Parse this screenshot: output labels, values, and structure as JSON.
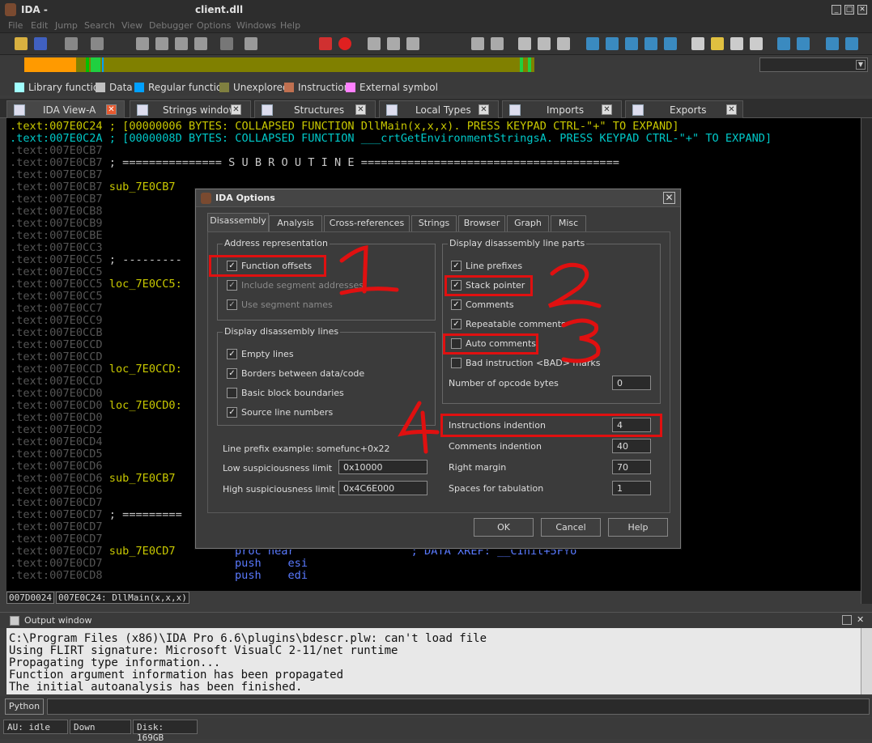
{
  "window": {
    "app": "IDA -",
    "file": "client.dll"
  },
  "menu": [
    "File",
    "Edit",
    "Jump",
    "Search",
    "View",
    "Debugger",
    "Options",
    "Windows",
    "Help"
  ],
  "legend": [
    {
      "label": "Library function",
      "color": "#a0ffff"
    },
    {
      "label": "Data",
      "color": "#c0c0c0"
    },
    {
      "label": "Regular function",
      "color": "#00a0ff"
    },
    {
      "label": "Unexplored",
      "color": "#808040"
    },
    {
      "label": "Instruction",
      "color": "#c07050"
    },
    {
      "label": "External symbol",
      "color": "#ff80ff"
    }
  ],
  "tabs": [
    {
      "label": "IDA View-A",
      "active": true
    },
    {
      "label": "Strings window"
    },
    {
      "label": "Structures"
    },
    {
      "label": "Local Types"
    },
    {
      "label": "Imports"
    },
    {
      "label": "Exports"
    }
  ],
  "disasm": {
    "lines": [
      {
        "addr": ".text:007E0C24",
        "text": " ; [00000006 BYTES: COLLAPSED FUNCTION DllMain(x,x,x). PRESS KEYPAD CTRL-\"+\" TO EXPAND]",
        "style": "y"
      },
      {
        "addr": ".text:007E0C2A",
        "text": " ; [0000008D BYTES: COLLAPSED FUNCTION ___crtGetEnvironmentStringsA. PRESS KEYPAD CTRL-\"+\" TO EXPAND]",
        "style": "c"
      },
      {
        "addr": ".text:007E0CB7",
        "text": "",
        "style": "g"
      },
      {
        "addr": ".text:007E0CB7",
        "text": " ; =============== S U B R O U T I N E =======================================",
        "style": "g"
      },
      {
        "addr": ".text:007E0CB7",
        "text": "",
        "style": "g"
      },
      {
        "addr": ".text:007E0CB7",
        "text": " sub_7E0CB7",
        "style": "g"
      },
      {
        "addr": ".text:007E0CB7",
        "text": "",
        "style": "g"
      },
      {
        "addr": ".text:007E0CB8",
        "text": "",
        "style": "g"
      },
      {
        "addr": ".text:007E0CB9",
        "text": "",
        "style": "g"
      },
      {
        "addr": ".text:007E0CBE",
        "text": "",
        "style": "g"
      },
      {
        "addr": ".text:007E0CC3",
        "text": "",
        "style": "g"
      },
      {
        "addr": ".text:007E0CC5",
        "text": " ; ---------",
        "style": "g"
      },
      {
        "addr": ".text:007E0CC5",
        "text": "",
        "style": "g"
      },
      {
        "addr": ".text:007E0CC5",
        "text": " loc_7E0CC5:",
        "style": "g"
      },
      {
        "addr": ".text:007E0CC5",
        "text": "",
        "style": "g"
      },
      {
        "addr": ".text:007E0CC7",
        "text": "",
        "style": "g"
      },
      {
        "addr": ".text:007E0CC9",
        "text": "",
        "style": "g"
      },
      {
        "addr": ".text:007E0CCB",
        "text": "",
        "style": "g"
      },
      {
        "addr": ".text:007E0CCD",
        "text": "",
        "style": "g"
      },
      {
        "addr": ".text:007E0CCD",
        "text": "",
        "style": "g"
      },
      {
        "addr": ".text:007E0CCD",
        "text": " loc_7E0CCD:",
        "style": "g"
      },
      {
        "addr": ".text:007E0CCD",
        "text": "",
        "style": "g"
      },
      {
        "addr": ".text:007E0CD0",
        "text": "",
        "style": "g"
      },
      {
        "addr": ".text:007E0CD0",
        "text": " loc_7E0CD0:",
        "style": "g"
      },
      {
        "addr": ".text:007E0CD0",
        "text": "",
        "style": "g"
      },
      {
        "addr": ".text:007E0CD2",
        "text": "",
        "style": "g"
      },
      {
        "addr": ".text:007E0CD4",
        "text": "",
        "style": "g"
      },
      {
        "addr": ".text:007E0CD5",
        "text": "",
        "style": "g"
      },
      {
        "addr": ".text:007E0CD6",
        "text": "",
        "style": "g"
      },
      {
        "addr": ".text:007E0CD6",
        "text": " sub_7E0CB7",
        "style": "g"
      },
      {
        "addr": ".text:007E0CD6",
        "text": "",
        "style": "g"
      },
      {
        "addr": ".text:007E0CD7",
        "text": "",
        "style": "g"
      },
      {
        "addr": ".text:007E0CD7",
        "text": " ; =========",
        "style": "g"
      },
      {
        "addr": ".text:007E0CD7",
        "text": "",
        "style": "g"
      },
      {
        "addr": ".text:007E0CD7",
        "text": "",
        "style": "g"
      },
      {
        "addr": ".text:007E0CD7",
        "text": " sub_7E0CD7",
        "style": "g"
      },
      {
        "addr": ".text:007E0CD7",
        "text": "",
        "style": "g"
      },
      {
        "addr": ".text:007E0CD8",
        "text": "",
        "style": "g"
      }
    ],
    "tail": [
      {
        "text": "proc near",
        "comment": "; DATA XREF: __CInit+5F↑o"
      },
      {
        "text": "push    esi",
        "comment": ""
      },
      {
        "text": "push    edi",
        "comment": ""
      }
    ],
    "status": [
      "007D0024",
      "007E0C24: DllMain(x,x,x)"
    ]
  },
  "dialog": {
    "title": "IDA Options",
    "tabs": [
      "Disassembly",
      "Analysis",
      "Cross-references",
      "Strings",
      "Browser",
      "Graph",
      "Misc"
    ],
    "address_group": {
      "title": "Address representation",
      "items": [
        {
          "label": "Function offsets",
          "checked": true,
          "enabled": true
        },
        {
          "label": "Include segment addresses",
          "checked": true,
          "enabled": false
        },
        {
          "label": "Use segment names",
          "checked": true,
          "enabled": false
        }
      ]
    },
    "lines_group": {
      "title": "Display disassembly lines",
      "items": [
        {
          "label": "Empty lines",
          "checked": true
        },
        {
          "label": "Borders between data/code",
          "checked": true
        },
        {
          "label": "Basic block boundaries",
          "checked": false
        },
        {
          "label": "Source line numbers",
          "checked": true
        }
      ]
    },
    "parts_group": {
      "title": "Display disassembly line parts",
      "items": [
        {
          "label": "Line prefixes",
          "checked": true
        },
        {
          "label": "Stack pointer",
          "checked": true
        },
        {
          "label": "Comments",
          "checked": true
        },
        {
          "label": "Repeatable comments",
          "checked": true
        },
        {
          "label": "Auto comments",
          "checked": false
        },
        {
          "label": "Bad instruction <BAD> marks",
          "checked": false
        }
      ],
      "opcode_label": "Number of opcode bytes",
      "opcode_value": "0"
    },
    "prefix_example": "Line prefix example: somefunc+0x22",
    "low_label": "Low suspiciousness limit",
    "low_value": "0x10000",
    "high_label": "High suspiciousness limit",
    "high_value": "0x4C6E000",
    "indent_fields": [
      {
        "label": "Instructions indention",
        "value": "4"
      },
      {
        "label": "Comments indention",
        "value": "40"
      },
      {
        "label": "Right margin",
        "value": "70"
      },
      {
        "label": "Spaces for tabulation",
        "value": "1"
      }
    ],
    "buttons": {
      "ok": "OK",
      "cancel": "Cancel",
      "help": "Help"
    }
  },
  "annotations": [
    "1",
    "2",
    "3",
    "4"
  ],
  "output": {
    "title": "Output window",
    "lines": [
      "C:\\Program Files (x86)\\IDA Pro 6.6\\plugins\\bdescr.plw: can't load file",
      "Using FLIRT signature: Microsoft VisualC 2-11/net runtime",
      "Propagating type information...",
      "Function argument information has been propagated",
      "The initial autoanalysis has been finished."
    ]
  },
  "python_button": "Python",
  "status": {
    "au": "AU:  idle",
    "dir": "Down",
    "disk": "Disk: 169GB"
  }
}
